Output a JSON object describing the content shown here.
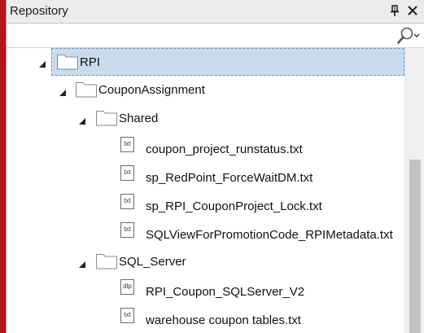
{
  "panel": {
    "title": "Repository",
    "pin_icon": "pin-icon",
    "close_icon": "close-icon",
    "search": {
      "value": "",
      "icon": "search-icon",
      "dropdown_icon": "chevron-down-icon"
    }
  },
  "tree": {
    "selected": "RPI",
    "nodes": [
      {
        "label": "RPI",
        "type": "folder",
        "expanded": true,
        "selected": true
      },
      {
        "label": "CouponAssignment",
        "type": "folder",
        "expanded": true
      },
      {
        "label": "Shared",
        "type": "folder",
        "expanded": true
      },
      {
        "label": "coupon_project_runstatus.txt",
        "type": "file",
        "badge": "txt"
      },
      {
        "label": "sp_RedPoint_ForceWaitDM.txt",
        "type": "file",
        "badge": "txt"
      },
      {
        "label": "sp_RPI_CouponProject_Lock.txt",
        "type": "file",
        "badge": "txt"
      },
      {
        "label": "SQLViewForPromotionCode_RPIMetadata.txt",
        "type": "file",
        "badge": "txt"
      },
      {
        "label": "SQL_Server",
        "type": "folder",
        "expanded": true
      },
      {
        "label": "RPI_Coupon_SQLServer_V2",
        "type": "file",
        "badge": "dlp"
      },
      {
        "label": "warehouse coupon tables.txt",
        "type": "file",
        "badge": "txt"
      }
    ]
  },
  "colors": {
    "selection_bg": "#c9dcee",
    "selection_border": "#6f93b6",
    "accent_red": "#b3151c"
  }
}
